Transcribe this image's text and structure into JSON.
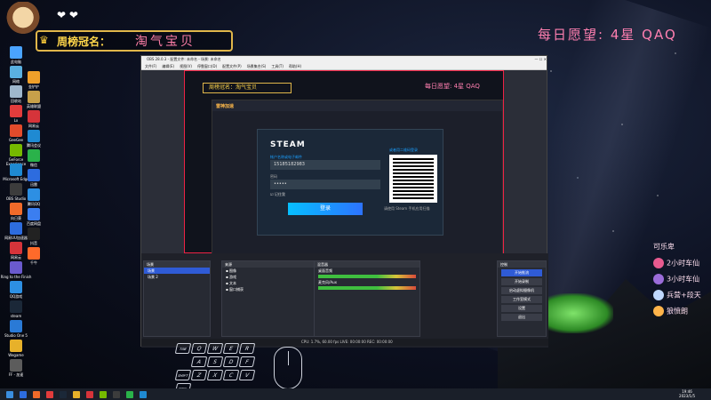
{
  "overlay": {
    "banner_label": "周榜冠名：",
    "banner_value": "淘气宝贝",
    "hearts": "❤ ❤",
    "wish": "每日愿望: 4星 QAQ",
    "leaderboard": [
      {
        "label": "可乐卑",
        "color": "#ffffff"
      },
      {
        "label": "2小时车仙",
        "color": "#e85a8f"
      },
      {
        "label": "3小时车仙",
        "color": "#9b6cd9"
      },
      {
        "label": "兵营+段天",
        "color": "#c0d8ff"
      },
      {
        "label": "狼愤朗",
        "color": "#ffb44a"
      }
    ]
  },
  "desktop_icons": [
    {
      "label": "此电脑",
      "color": "#4aa3ff"
    },
    {
      "label": "网络",
      "color": "#5ab0e0"
    },
    {
      "label": "回收站",
      "color": "#9fb7cc"
    },
    {
      "label": "Lx",
      "color": "#e23c3c"
    },
    {
      "label": "GeeGee",
      "color": "#e24b2b"
    },
    {
      "label": "GeForce Experience",
      "color": "#76b900"
    },
    {
      "label": "Microsoft Edge",
      "color": "#1f8ad2"
    },
    {
      "label": "OBS Studio",
      "color": "#3c3c3c"
    },
    {
      "label": "向日葵",
      "color": "#f06a2a"
    },
    {
      "label": "网易UU加速器",
      "color": "#2d6cdf"
    },
    {
      "label": "网易云",
      "color": "#d6343a"
    },
    {
      "label": "Ring to the Finish",
      "color": "#6a5acd"
    },
    {
      "label": "QQ游戏",
      "color": "#2d8fe3"
    },
    {
      "label": "steam",
      "color": "#1b2838"
    },
    {
      "label": "Studio One 5",
      "color": "#2a7ad6"
    },
    {
      "label": "Wegame",
      "color": "#e7b12a"
    },
    {
      "label": "FF - 加速",
      "color": "#5c5c5c"
    }
  ],
  "desktop_icons_col2": [
    {
      "label": "金铲铲",
      "color": "#f0a02a"
    },
    {
      "label": "英雄联盟",
      "color": "#c7a04a"
    },
    {
      "label": "网易云",
      "color": "#d6343a"
    },
    {
      "label": "腾讯会议",
      "color": "#1f8ad2"
    },
    {
      "label": "微信",
      "color": "#2ab24a"
    },
    {
      "label": "迅雷",
      "color": "#2d6cdf"
    },
    {
      "label": "腾讯QQ",
      "color": "#2d8fe3"
    },
    {
      "label": "百度网盘",
      "color": "#3b7ef0"
    },
    {
      "label": "抖音",
      "color": "#222222"
    },
    {
      "label": "千牛",
      "color": "#ff6a2a"
    }
  ],
  "obs": {
    "title": "OBS 28.0.3 - 配置文件: 未命名 - 场景: 未命名",
    "menu": [
      "文件(F)",
      "编辑(E)",
      "视图(V)",
      "停靠窗口(D)",
      "配置文件(P)",
      "场景集合(S)",
      "工具(T)",
      "帮助(H)"
    ],
    "inner_banner": "周榜冠名：淘气宝贝",
    "inner_wish": "每日愿望: 4星 QAQ",
    "app_name": "雷神加速",
    "steam": {
      "brand": "STEAM",
      "account_label": "帐户名称或电子邮件",
      "account_value": "15185182983",
      "password_label": "密码",
      "password_value": "•••••",
      "remember": "记住我",
      "login": "登录",
      "qr_label": "或者用二维码登录",
      "qr_hint": "请使用 Steam 手机应用扫描"
    },
    "scenes_header": "场景",
    "scenes": [
      "场景",
      "场景 2"
    ],
    "sources_header": "来源",
    "sources": [
      "图像",
      "游戏",
      "文本",
      "窗口捕获"
    ],
    "mixer_header": "混音器",
    "mixer": [
      "桌面音频",
      "麦克风/Aux"
    ],
    "controls_header": "控制",
    "controls": [
      "开始推流",
      "开始录制",
      "启动虚拟摄像机",
      "工作室模式",
      "设置",
      "退出"
    ],
    "status": "CPU: 1.7%, 60.00 fps    LIVE: 00:00:00    REC: 00:00:00"
  },
  "taskbar": {
    "time": "19:46",
    "date": "2023/1/5",
    "items": [
      "#2d6cdf",
      "#f06a2a",
      "#e23c3c",
      "#1b2838",
      "#e7b12a",
      "#d6343a",
      "#76b900",
      "#3c3c3c",
      "#2ab24a",
      "#1f8ad2"
    ]
  },
  "keys": [
    "TAB",
    "Q",
    "W",
    "E",
    "R",
    "A",
    "S",
    "D",
    "F",
    "SHIFT",
    "Z",
    "X",
    "C",
    "V",
    "CTRL"
  ]
}
